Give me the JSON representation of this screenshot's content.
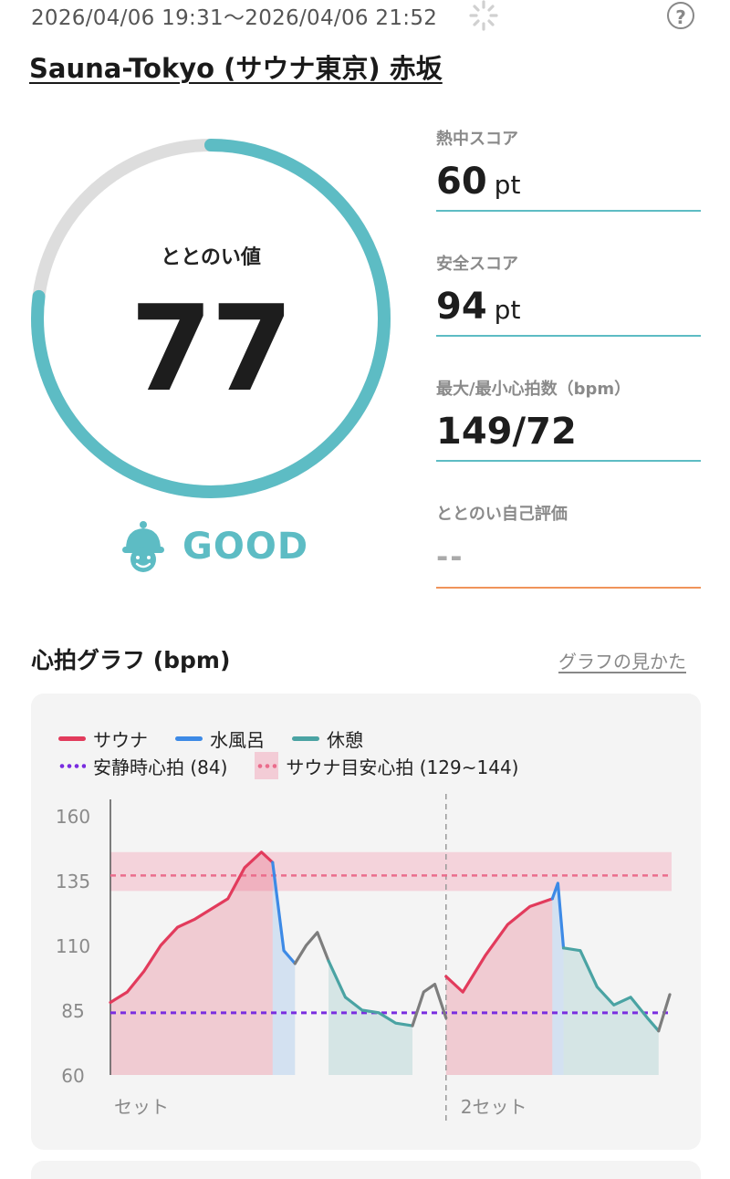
{
  "header": {
    "datetime": "2026/04/06 19:31～2026/04/06 21:52",
    "help_label": "?",
    "venue": "Sauna-Tokyo (サウナ東京) 赤坂"
  },
  "score": {
    "label": "ととのい値",
    "value": "77",
    "progress": 0.77,
    "rating": "GOOD",
    "ring_color": "#5dbcc4",
    "track_color": "#dddddd"
  },
  "metrics": [
    {
      "label": "熱中スコア",
      "value": "60",
      "unit": "pt"
    },
    {
      "label": "安全スコア",
      "value": "94",
      "unit": "pt"
    },
    {
      "label": "最大/最小心拍数（bpm）",
      "value": "149/72",
      "unit": ""
    },
    {
      "label": "ととのい自己評価",
      "value": "--",
      "unit": ""
    }
  ],
  "graph": {
    "title": "心拍グラフ (bpm)",
    "link": "グラフの見かた",
    "legend": {
      "sauna": "サウナ",
      "cold_bath": "水風呂",
      "rest": "休憩",
      "resting_hr": "安静時心拍 (84)",
      "sauna_target": "サウナ目安心拍 (129~144)"
    },
    "colors": {
      "sauna": "#e23b5c",
      "cold_bath": "#3d8ae6",
      "rest": "#4aa3a3",
      "other": "#7d7d7d",
      "resting": "#7a2ee0",
      "target": "#ea6d8c"
    }
  },
  "chart_data": {
    "type": "line",
    "ylim": [
      60,
      160
    ],
    "yticks": [
      60,
      85,
      110,
      135,
      160
    ],
    "ytick_labels": [
      "60",
      "85",
      "110",
      "135",
      "160"
    ],
    "xlabels": [
      "セット",
      "2セット"
    ],
    "resting_hr": 84,
    "target_band": [
      131,
      146
    ],
    "target_line": 137,
    "set_divider": 0.6,
    "segments": [
      {
        "phase": "sauna",
        "t": [
          0.0,
          0.03,
          0.06,
          0.09,
          0.12,
          0.15,
          0.18,
          0.21,
          0.24,
          0.27,
          0.29
        ],
        "hr": [
          88,
          92,
          100,
          110,
          117,
          120,
          124,
          128,
          140,
          146,
          142
        ]
      },
      {
        "phase": "cold_bath",
        "t": [
          0.29,
          0.31,
          0.33
        ],
        "hr": [
          142,
          108,
          103
        ]
      },
      {
        "phase": "other",
        "t": [
          0.33,
          0.35,
          0.37,
          0.39
        ],
        "hr": [
          103,
          110,
          115,
          104
        ]
      },
      {
        "phase": "rest",
        "t": [
          0.39,
          0.42,
          0.45,
          0.48,
          0.51,
          0.54
        ],
        "hr": [
          104,
          90,
          85,
          84,
          80,
          79
        ]
      },
      {
        "phase": "other",
        "t": [
          0.54,
          0.56,
          0.58,
          0.6
        ],
        "hr": [
          79,
          92,
          95,
          82
        ]
      },
      {
        "phase": "sauna",
        "t": [
          0.6,
          0.63,
          0.67,
          0.71,
          0.75,
          0.79
        ],
        "hr": [
          98,
          92,
          106,
          118,
          125,
          128
        ]
      },
      {
        "phase": "cold_bath",
        "t": [
          0.79,
          0.8,
          0.81
        ],
        "hr": [
          128,
          134,
          109
        ]
      },
      {
        "phase": "rest",
        "t": [
          0.81,
          0.84,
          0.87,
          0.9,
          0.93,
          0.96,
          0.98
        ],
        "hr": [
          109,
          108,
          94,
          87,
          90,
          82,
          77
        ]
      },
      {
        "phase": "other",
        "t": [
          0.98,
          1.0
        ],
        "hr": [
          77,
          91
        ]
      }
    ]
  }
}
